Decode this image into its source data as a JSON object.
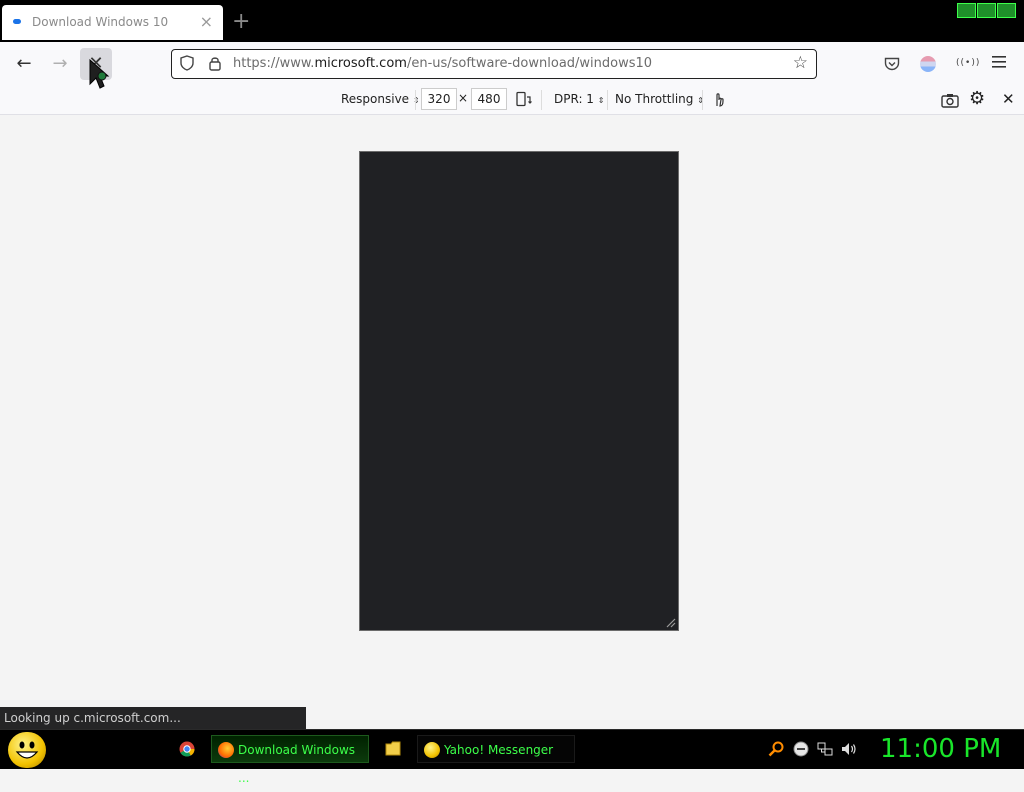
{
  "tab": {
    "title": "Download Windows 10",
    "close_label": "×"
  },
  "newtab_label": "+",
  "nav": {
    "back_label": "←",
    "forward_label": "→",
    "stop_label": "✕"
  },
  "urlbar": {
    "url_prefix": "https://www.",
    "url_domain": "microsoft.com",
    "url_path": "/en-us/software-download/windows10",
    "star_label": "☆"
  },
  "toolbar": {
    "extension_label": "((•))"
  },
  "rdm": {
    "device": "Responsive",
    "width": "320",
    "times": "×",
    "height": "480",
    "dpr": "DPR: 1",
    "throttling": "No Throttling",
    "close_label": "✕"
  },
  "status": {
    "text": "Looking up c.microsoft.com..."
  },
  "taskbar": {
    "firefox_label": "Download Windows ...",
    "yahoo_label": "Yahoo! Messenger",
    "clock": "11:00 PM"
  },
  "colors": {
    "viewport_bg": "#202124",
    "taskbar_accent": "#3cff4a",
    "clock": "#19e62a"
  }
}
